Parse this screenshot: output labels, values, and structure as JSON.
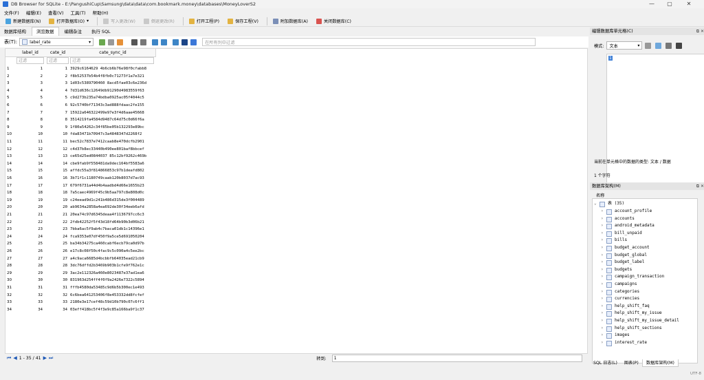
{
  "window": {
    "title": "DB Browser for SQLite - E:\\PangushiCup\\Samsung\\data\\data\\com.bookmark.money\\databases\\MoneyLoverS2",
    "min": "—",
    "max": "▢",
    "close": "✕"
  },
  "menu": [
    "文件(F)",
    "编辑(E)",
    "查看(V)",
    "工具(T)",
    "帮助(H)"
  ],
  "toolbar": {
    "new_db": "新建数据库(N)",
    "open_db": "打开数据库(O)",
    "write_changes": "写入更改(W)",
    "revert_changes": "倒退更改(R)",
    "open_project": "打开工程(P)",
    "save_project": "保存工程(V)",
    "attach_db": "附加数据库(A)",
    "close_db": "关闭数据库(C)"
  },
  "tabs": [
    "数据库结构",
    "浏览数据",
    "编辑杂注",
    "执行 SQL"
  ],
  "browse": {
    "table_label": "表(T):",
    "table_name": "label_rate",
    "filter_placeholder": "在所有列中过滤"
  },
  "columns": [
    "label_id",
    "cate_id",
    "cate_sync_id"
  ],
  "filter_text": "过滤",
  "rows": [
    [
      "1",
      "1",
      "1",
      "3929c6164629 4b6cb6b76e98f0cfabb8"
    ],
    [
      "2",
      "2",
      "2",
      "f8b52537b54b4f8fb0c71273f1a7e321"
    ],
    [
      "3",
      "3",
      "3",
      "1d03c5389790460 8acd5fae03c6e236d"
    ],
    [
      "4",
      "4",
      "4",
      "7d31d636c12649db91290d4983559f63"
    ],
    [
      "5",
      "5",
      "5",
      "c9d273b235a74bdba0925ac05f4044c5"
    ],
    [
      "6",
      "6",
      "6",
      "92c5740bf71343c3ad888fdaac2fe155"
    ],
    [
      "7",
      "7",
      "7",
      "15922a646322499e97e3f4d6aae45668"
    ],
    [
      "8",
      "8",
      "8",
      "3514219fa4584d9487c64d75c0d66f6a"
    ],
    [
      "9",
      "9",
      "9",
      "1f80a54262c34f85be05b132293e89bc"
    ],
    [
      "10",
      "10",
      "10",
      "fda83471b70947c3a4848347d2268f2"
    ],
    [
      "11",
      "11",
      "11",
      "bec52c7837e7412caab8e470dcfb2901"
    ],
    [
      "12",
      "12",
      "12",
      "c4d37b8ec33440b490ee801baf8bbcef"
    ],
    [
      "13",
      "13",
      "13",
      "ce65d25ed0844037 85c12bf9262c469b"
    ],
    [
      "14",
      "14",
      "14",
      "cbe9fab9f558481da9dec164bf5583a6"
    ],
    [
      "15",
      "15",
      "15",
      "affdc55a3f814866853c97b1deafd802"
    ],
    [
      "16",
      "16",
      "16",
      "3b71f1c1180749caab120b8037d7ac93"
    ],
    [
      "17",
      "17",
      "17",
      "679f6731a44d4b4aadbd4d66e1655b23"
    ],
    [
      "18",
      "18",
      "18",
      "7a5caec4969f45c9b5aa797c8e808d0c"
    ],
    [
      "19",
      "19",
      "19",
      "c24eead9d1c241b486d315de3f004489"
    ],
    [
      "20",
      "20",
      "20",
      "ab9634a2858a4ea692de30f34eeb6afd"
    ],
    [
      "21",
      "21",
      "21",
      "20ea74c97d6345deaa4f1136797cc6c3"
    ],
    [
      "22",
      "22",
      "22",
      "2fdb42252f5f43d18fd64b90b3d06b21"
    ],
    [
      "23",
      "23",
      "23",
      "7bba6ac5f9ab4c7baca01db1c14396e1"
    ],
    [
      "24",
      "24",
      "24",
      "fca9353e07df450f9a5ce5d691050204"
    ],
    [
      "25",
      "25",
      "25",
      "ba34b34275ca460cabf6ecb79ca0d97b"
    ],
    [
      "26",
      "26",
      "26",
      "e17c8c08f50c4fac9c5c090a4c5ee2bc"
    ],
    [
      "27",
      "27",
      "27",
      "a4c9aca6685d4bcbbfb64035ead21cb9"
    ],
    [
      "28",
      "28",
      "28",
      "3dc76dffd2b3469b903b1cfe9f762e1c"
    ],
    [
      "29",
      "29",
      "29",
      "3ac2e112326a460e8023487e37ad1ea6"
    ],
    [
      "30",
      "30",
      "30",
      "831963d254ff4f0f9a2426e7322c5894"
    ],
    [
      "31",
      "31",
      "31",
      "fffb4580da53485c9d6b5b300ec1e493"
    ],
    [
      "32",
      "32",
      "32",
      "6c6bea641253406f8e453332dd8fcfef"
    ],
    [
      "33",
      "33",
      "33",
      "2180e3e17cef48c59d10b790c07c6ff1"
    ],
    [
      "34",
      "34",
      "34",
      "03eff418bc5f4f3e9c85a166ba9f1c37"
    ]
  ],
  "nav": {
    "first": "⏮",
    "prev": "◀",
    "range": "1 - 35 / 41",
    "next": "▶",
    "last": "⏭",
    "goto_label": "转到:",
    "goto_value": "1"
  },
  "edit_cell": {
    "title": "编辑数据库单元格(C)",
    "mode_label": "模式:",
    "mode_value": "文本",
    "cell_value": "1",
    "type_info": "当前在单元格中的数据的类型: 文本 / 数据",
    "size_info": "1 个字符"
  },
  "db_schema": {
    "title": "数据库架构(M)",
    "name_header": "名称",
    "tables_label": "表 (35)",
    "tables": [
      "account_profile",
      "accounts",
      "android_metadata",
      "bill_unpaid",
      "bills",
      "budget_account",
      "budget_global",
      "budget_label",
      "budgets",
      "campaign_transaction",
      "campaigns",
      "categories",
      "currencies",
      "help_shift_faq",
      "help_shift_my_issue",
      "help_shift_my_issue_detail",
      "help_shift_sections",
      "images",
      "interest_rate"
    ]
  },
  "bottom_tabs": [
    "SQL 日志(L)",
    "图表(P)",
    "数据库架构(M)"
  ],
  "status": "UTF-8"
}
